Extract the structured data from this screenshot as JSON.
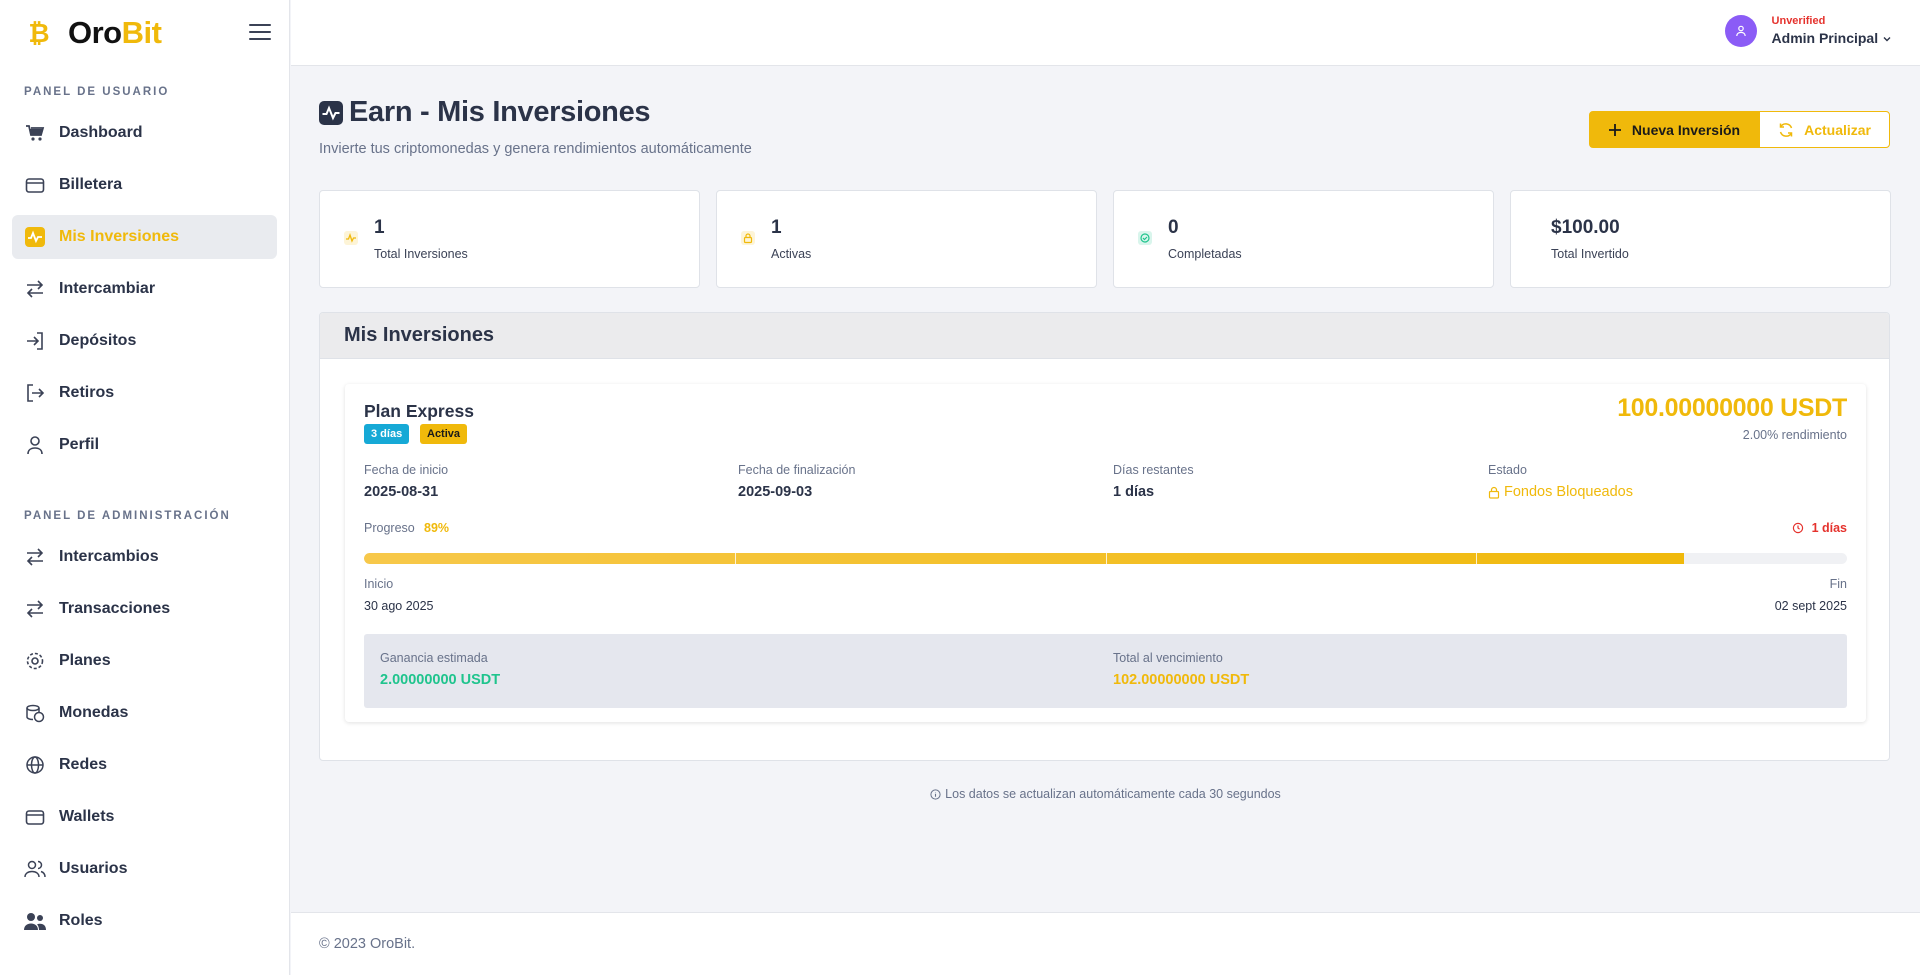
{
  "brand": {
    "name_part1": "Oro",
    "name_part2": "Bit"
  },
  "sidebar": {
    "user_section": "PANEL DE USUARIO",
    "user_items": [
      {
        "label": "Dashboard",
        "icon": "cart-icon"
      },
      {
        "label": "Billetera",
        "icon": "wallet-icon"
      },
      {
        "label": "Mis Inversiones",
        "icon": "activity-icon",
        "active": true
      },
      {
        "label": "Intercambiar",
        "icon": "swap-icon"
      },
      {
        "label": "Depósitos",
        "icon": "login-icon"
      },
      {
        "label": "Retiros",
        "icon": "logout-icon"
      },
      {
        "label": "Perfil",
        "icon": "user-icon"
      }
    ],
    "admin_section": "PANEL DE ADMINISTRACIÓN",
    "admin_items": [
      {
        "label": "Intercambios",
        "icon": "swap-icon"
      },
      {
        "label": "Transacciones",
        "icon": "swap-icon"
      },
      {
        "label": "Planes",
        "icon": "gear-icon"
      },
      {
        "label": "Monedas",
        "icon": "coins-icon"
      },
      {
        "label": "Redes",
        "icon": "globe-icon"
      },
      {
        "label": "Wallets",
        "icon": "wallet-icon"
      },
      {
        "label": "Usuarios",
        "icon": "users-icon"
      },
      {
        "label": "Roles",
        "icon": "roles-icon"
      }
    ]
  },
  "user": {
    "status": "Unverified",
    "name": "Admin Principal"
  },
  "page": {
    "title": "Earn - Mis Inversiones",
    "subtitle": "Invierte tus criptomonedas y genera rendimientos automáticamente",
    "new_button": "Nueva Inversión",
    "refresh_button": "Actualizar"
  },
  "stats": [
    {
      "value": "1",
      "label": "Total Inversiones",
      "icon": "activity-icon"
    },
    {
      "value": "1",
      "label": "Activas",
      "icon": "lock-icon"
    },
    {
      "value": "0",
      "label": "Completadas",
      "icon": "check-circle-icon"
    },
    {
      "value": "$100.00",
      "label": "Total Invertido"
    }
  ],
  "investments": {
    "title": "Mis Inversiones",
    "card": {
      "plan": "Plan Express",
      "days_badge": "3 días",
      "status_badge": "Activa",
      "amount": "100.00000000 USDT",
      "yield": "2.00% rendimiento",
      "start_label": "Fecha de inicio",
      "start_value": "2025-08-31",
      "end_label": "Fecha de finalización",
      "end_value": "2025-09-03",
      "remaining_label": "Días restantes",
      "remaining_value": "1 días",
      "state_label": "Estado",
      "state_value": "Fondos Bloqueados",
      "progress_label": "Progreso",
      "progress_pct": "89%",
      "progress": 0.89,
      "time_left": "1 días",
      "begin_label": "Inicio",
      "begin_date": "30 ago 2025",
      "finish_label": "Fin",
      "finish_date": "02 sept 2025",
      "gain_label": "Ganancia estimada",
      "gain_value": "2.00000000 USDT",
      "total_label": "Total al vencimiento",
      "total_value": "102.00000000 USDT"
    }
  },
  "note": "Los datos se actualizan automáticamente cada 30 segundos",
  "footer": "© 2023 OroBit.",
  "colors": {
    "accent": "#f0b90b",
    "green": "#1fc48d",
    "red": "#e5322d",
    "cyan": "#16a9d6",
    "avatar": "#8b5cf6"
  }
}
